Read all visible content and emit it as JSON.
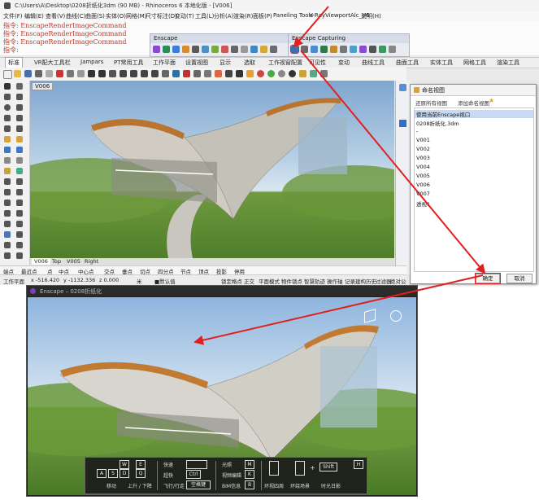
{
  "titlebar": {
    "title": "C:\\Users\\A\\Desktop\\0208折纸化3dm (90 MB) - Rhinoceros 6 本地化版 - [V006]"
  },
  "menu": [
    "文件(F)",
    "编辑(E)",
    "查看(V)",
    "曲线(C)",
    "曲面(S)",
    "实体(O)",
    "网格(M)",
    "尺寸标注(D)",
    "变动(T)",
    "工具(L)",
    "分析(A)",
    "渲染(R)",
    "面板(P)",
    "Paneling Tools",
    "V-Ray",
    "ViewportAlc_V6",
    "说明(H)"
  ],
  "command_lines": [
    "指令: EnscapeRenderImageCommand",
    "指令: EnscapeRenderImageCommand",
    "指令: EnscapeRenderImageCommand",
    "指令:"
  ],
  "enscape_toolbar": {
    "title": "Enscape"
  },
  "enscape_capturing": {
    "title": "Enscape Capturing"
  },
  "tabs": [
    {
      "label": "标准",
      "active": true
    },
    {
      "label": "VR配大工具栏"
    },
    {
      "label": "Jampars"
    },
    {
      "label": "PT常用工具"
    },
    {
      "label": "工作平面"
    },
    {
      "label": "设置视图"
    },
    {
      "label": "显示"
    },
    {
      "label": "选取"
    },
    {
      "label": "工作视窗配置"
    },
    {
      "label": "可见性"
    },
    {
      "label": "变动"
    },
    {
      "label": "曲线工具"
    },
    {
      "label": "曲面工具"
    },
    {
      "label": "实体工具"
    },
    {
      "label": "网格工具"
    },
    {
      "label": "渲染工具"
    }
  ],
  "viewport": {
    "label": "V006"
  },
  "view_tabs": [
    {
      "label": "V006",
      "active": true
    },
    {
      "label": "Top"
    },
    {
      "label": "V005"
    },
    {
      "label": "Right"
    }
  ],
  "osnaps": [
    "端点",
    "最近点",
    "点",
    "中点",
    "中心点",
    "交点",
    "垂点",
    "切点",
    "四分点",
    "节点",
    "顶点",
    "投影",
    "停用"
  ],
  "status": {
    "plane": "工作平面",
    "x": "x -516.420",
    "y": "y -1132.336",
    "z": "z 0.000",
    "unit": "米",
    "layer": "■默认值",
    "items": [
      "锁定格点",
      "正交",
      "平面模式",
      "物件锁点",
      "智慧轨迹",
      "操作轴",
      "记录建构历史",
      "过滤器",
      "绝对公差"
    ]
  },
  "dialog": {
    "title": "命名视图",
    "subtitle_left": "还原所有视图",
    "subtitle_right": "添加命名视图",
    "rows": [
      {
        "label": "使用当前Enscape视口",
        "selected": true
      },
      {
        "label": "0208折纸化.3dm"
      },
      {
        "label": "-"
      },
      {
        "label": "V001"
      },
      {
        "label": "V002"
      },
      {
        "label": "V003"
      },
      {
        "label": "V004"
      },
      {
        "label": "V005"
      },
      {
        "label": "V006"
      },
      {
        "label": "V007"
      },
      {
        "label": "透视1"
      }
    ],
    "ok_label": "确定",
    "cancel_label": "取消"
  },
  "enscape_window": {
    "title": "Enscape – 0208折纸化"
  },
  "controls": {
    "keys": {
      "w": "W",
      "e": "E",
      "a": "A",
      "s": "S",
      "d": "D",
      "q": "Q",
      "ctrl": "Ctrl",
      "space": "空格键",
      "m": "M",
      "k": "K",
      "b": "B",
      "shift": "Shift",
      "h": "H",
      "plus": "+"
    },
    "labels": {
      "move": "移动",
      "updown": "上升 / 下降",
      "fast": "快速",
      "superfast": "超快",
      "fly_walk": "飞行/行走",
      "timeline": "光照",
      "video_editor": "视频编辑",
      "bim": "BIM信息",
      "look_around": "环视四周",
      "orbit": "环绕场景",
      "daytime": "时光日影"
    }
  },
  "colors": {
    "arrow": "#e02020",
    "render_bg": "#1e1e1e",
    "selected_row": "#c6daf3"
  }
}
